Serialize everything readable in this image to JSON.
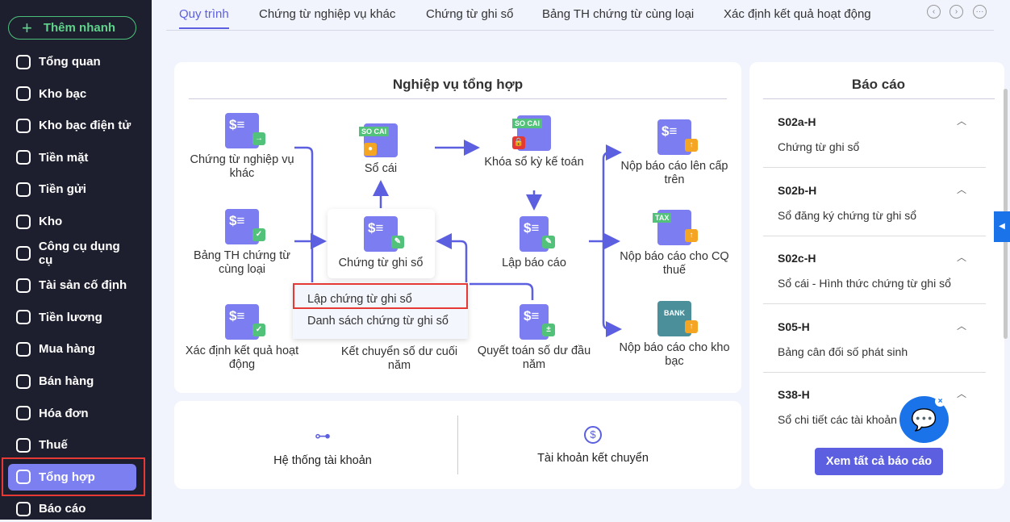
{
  "sidebar": {
    "quick_add": "Thêm nhanh",
    "items": [
      {
        "label": "Tổng quan",
        "icon": "pie-chart-icon"
      },
      {
        "label": "Kho bạc",
        "icon": "treasury-icon"
      },
      {
        "label": "Kho bạc điện tử",
        "icon": "e-treasury-icon"
      },
      {
        "label": "Tiền mặt",
        "icon": "cash-icon"
      },
      {
        "label": "Tiền gửi",
        "icon": "deposit-icon"
      },
      {
        "label": "Kho",
        "icon": "warehouse-icon"
      },
      {
        "label": "Công cụ dụng cụ",
        "icon": "tools-icon"
      },
      {
        "label": "Tài sản cố định",
        "icon": "truck-icon"
      },
      {
        "label": "Tiền lương",
        "icon": "salary-icon"
      },
      {
        "label": "Mua hàng",
        "icon": "cart-icon"
      },
      {
        "label": "Bán hàng",
        "icon": "store-icon"
      },
      {
        "label": "Hóa đơn",
        "icon": "invoice-icon"
      },
      {
        "label": "Thuế",
        "icon": "bank-icon"
      },
      {
        "label": "Tổng hợp",
        "icon": "summary-icon",
        "active": true
      },
      {
        "label": "Báo cáo",
        "icon": "report-icon"
      }
    ]
  },
  "tabs": [
    "Quy trình",
    "Chứng từ nghiệp vụ khác",
    "Chứng từ ghi sổ",
    "Bảng TH chứng từ cùng loại",
    "Xác định kết quả hoạt động"
  ],
  "diagram": {
    "title": "Nghiệp vụ tổng hợp",
    "nodes": {
      "ctnvk": "Chứng từ nghiệp vụ khác",
      "bangth": "Bảng TH chứng từ cùng loại",
      "xdkq": "Xác định kết quả hoạt động",
      "socai": "Sổ cái",
      "ctgs": "Chứng từ ghi sổ",
      "ketchuyen": "Kết chuyển số dư cuối năm",
      "khoaso": "Khóa sổ kỳ kế toán",
      "lapbc": "Lập báo cáo",
      "quyettoan": "Quyết toán số dư đầu năm",
      "nopcaptren": "Nộp báo cáo lên cấp trên",
      "nopthue": "Nộp báo cáo cho CQ thuế",
      "nopkhobac": "Nộp báo cáo cho kho bạc"
    },
    "tags": {
      "socai": "SO CAI",
      "tax": "TAX",
      "bank": "BANK"
    },
    "menu": [
      "Lập chứng từ ghi sổ",
      "Danh sách chứng từ ghi sổ"
    ]
  },
  "bottom": {
    "accounts": "Hệ thống tài khoản",
    "transfer": "Tài khoản kết chuyển"
  },
  "reports": {
    "title": "Báo cáo",
    "items": [
      {
        "code": "S02a-H",
        "desc": "Chứng từ ghi sổ"
      },
      {
        "code": "S02b-H",
        "desc": "Sổ đăng ký chứng từ ghi sổ"
      },
      {
        "code": "S02c-H",
        "desc": "Sổ cái - Hình thức chứng từ ghi sổ"
      },
      {
        "code": "S05-H",
        "desc": "Bảng cân đối số phát sinh"
      },
      {
        "code": "S38-H",
        "desc": "Sổ chi tiết các tài khoản"
      }
    ],
    "view_all": "Xem tất cả báo cáo"
  },
  "colors": {
    "accent": "#5b5fe0",
    "sidebar": "#1e1f2e",
    "highlight": "#e53935"
  }
}
